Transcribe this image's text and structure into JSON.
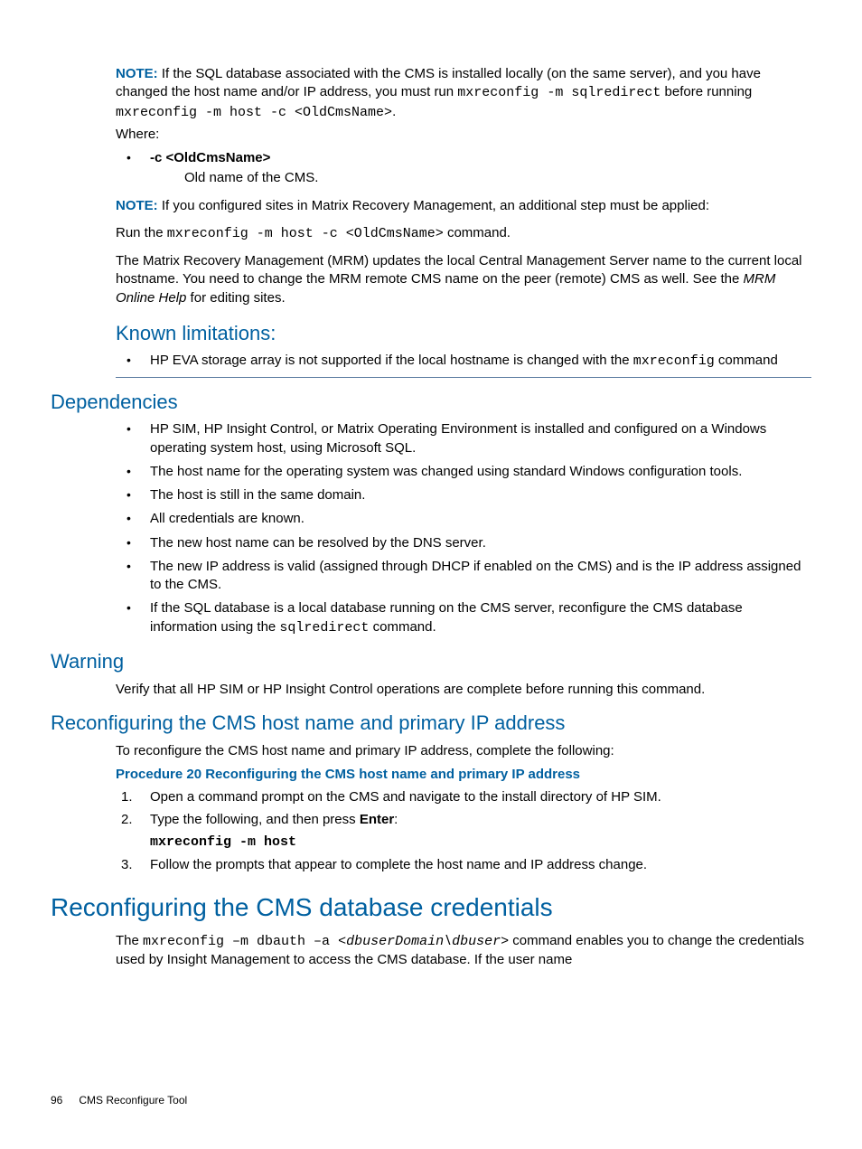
{
  "note1": {
    "label": "NOTE:",
    "t1": "If the SQL database associated with the CMS is installed locally (on the same server), and you have changed the host name and/or IP address, you must run ",
    "c1": "mxreconfig -m sqlredirect",
    "t2": " before running ",
    "c2": "mxreconfig -m host -c <OldCmsName>",
    "t3": ".",
    "where": "Where:",
    "opt": "-c <OldCmsName>",
    "optdesc": "Old name of the CMS."
  },
  "note2": {
    "label": "NOTE:",
    "t1": "If you configured sites in Matrix Recovery Management, an additional step must be applied:",
    "run_pre": "Run the ",
    "run_cmd": "mxreconfig -m host -c <OldCmsName>",
    "run_post": " command.",
    "mrm1": "The Matrix Recovery Management (MRM) updates the local Central Management Server name to the current local hostname. You need to change the MRM remote CMS name on the peer (remote) CMS as well. See the ",
    "mrm_em": "MRM Online Help",
    "mrm2": " for editing sites."
  },
  "kl": {
    "heading": "Known limitations:",
    "item_pre": "HP EVA storage array is not supported if the local hostname is changed with the ",
    "item_cmd": "mxreconfig",
    "item_post": " command"
  },
  "dep": {
    "heading": "Dependencies",
    "i1": "HP SIM, HP Insight Control, or Matrix Operating Environment is installed and configured on a Windows operating system host, using Microsoft SQL.",
    "i2": "The host name for the operating system was changed using standard Windows configuration tools.",
    "i3": "The host is still in the same domain.",
    "i4": "All credentials are known.",
    "i5": "The new host name can be resolved by the DNS server.",
    "i6": "The new IP address is valid (assigned through DHCP if enabled on the CMS) and is the IP address assigned to the CMS.",
    "i7_pre": "If the SQL database is a local database running on the CMS server, reconfigure the CMS database information using the ",
    "i7_cmd": "sqlredirect",
    "i7_post": " command."
  },
  "warn": {
    "heading": "Warning",
    "text": "Verify that all HP SIM or HP Insight Control operations are complete before running this command."
  },
  "recfg": {
    "heading": "Reconfiguring the CMS host name and primary IP address",
    "intro": "To reconfigure the CMS host name and primary IP address, complete the following:",
    "prochead": "Procedure 20 Reconfiguring the CMS host name and primary IP address",
    "s1": "Open a command prompt on the CMS and navigate to the install directory of HP SIM.",
    "s2_pre": "Type the following, and then press ",
    "s2_b": "Enter",
    "s2_post": ":",
    "s2_cmd": "mxreconfig -m host",
    "s3": "Follow the prompts that appear to complete the host name and IP address change."
  },
  "db": {
    "heading": "Reconfiguring the CMS database credentials",
    "t1": "The ",
    "c1": "mxreconfig –m dbauth –a ",
    "c2": "<dbuserDomain\\dbuser>",
    "t2": " command enables you to change the credentials used by Insight Management to access the CMS database. If the user name"
  },
  "footer": {
    "page": "96",
    "title": "CMS Reconfigure Tool"
  }
}
